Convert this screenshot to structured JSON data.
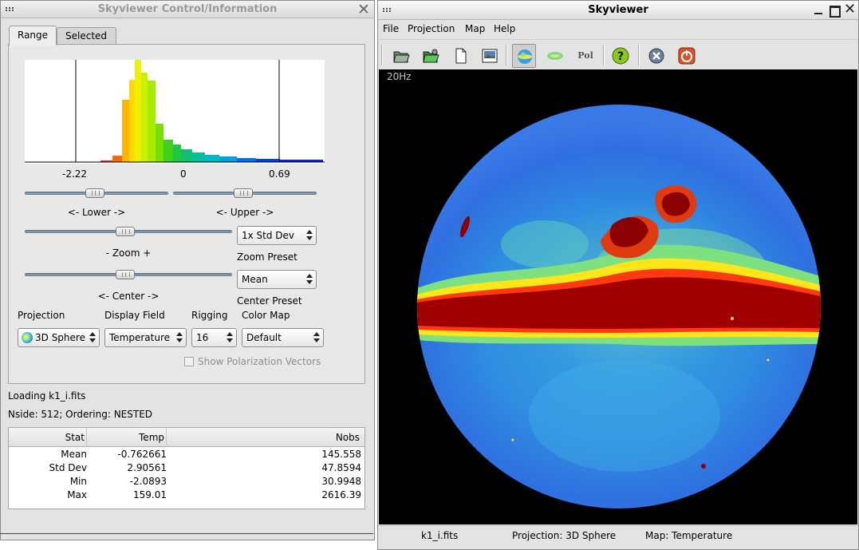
{
  "control_window": {
    "title": "Skyviewer Control/Information",
    "tabs": [
      {
        "label": "Range"
      },
      {
        "label": "Selected"
      }
    ],
    "histogram": {
      "min_label": "-2.22",
      "zero_label": "0",
      "max_label": "0.69"
    },
    "sliders": {
      "lower_label": "<- Lower ->",
      "upper_label": "<- Upper ->",
      "zoom_label": "-  Zoom  +",
      "center_label": "<-  Center  ->"
    },
    "zoom_preset": {
      "label": "Zoom Preset",
      "value": "1x Std Dev"
    },
    "center_preset": {
      "label": "Center Preset",
      "value": "Mean"
    },
    "projection": {
      "label": "Projection",
      "value": "3D Sphere"
    },
    "display_field": {
      "label": "Display Field",
      "value": "Temperature"
    },
    "rigging": {
      "label": "Rigging",
      "value": "16"
    },
    "color_map": {
      "label": "Color Map",
      "value": "Default"
    },
    "show_polarization_vectors": "Show Polarization Vectors",
    "loading_status": "Loading  k1_i.fits",
    "nside_info": "Nside:  512;  Ordering:  NESTED",
    "stats_table": {
      "columns": [
        "Stat",
        "Temp",
        "Nobs"
      ],
      "rows": [
        {
          "stat": "Mean",
          "temp": "-0.762661",
          "nobs": "145.558"
        },
        {
          "stat": "Std Dev",
          "temp": "2.90561",
          "nobs": "47.8594"
        },
        {
          "stat": "Min",
          "temp": "-2.0893",
          "nobs": "30.9948"
        },
        {
          "stat": "Max",
          "temp": "159.01",
          "nobs": "2616.39"
        }
      ]
    }
  },
  "sky_window": {
    "title": "Skyviewer",
    "menus": [
      "File",
      "Projection",
      "Map",
      "Help"
    ],
    "toolbar": {
      "pol_label": "Pol",
      "icons": [
        "open-folder-icon",
        "save-folder-icon",
        "new-document-icon",
        "image-icon",
        "sphere-projection-icon",
        "mollweide-projection-icon",
        "polarization-icon",
        "help-icon",
        "close-map-icon",
        "quit-icon"
      ]
    },
    "frequency_label": "20Hz",
    "status": {
      "file": "k1_i.fits",
      "projection": "Projection: 3D Sphere",
      "map": "Map: Temperature"
    },
    "colors": {
      "hot": "#8b0000",
      "warm": "#f5e51a",
      "cool": "#2f8fe0"
    }
  }
}
